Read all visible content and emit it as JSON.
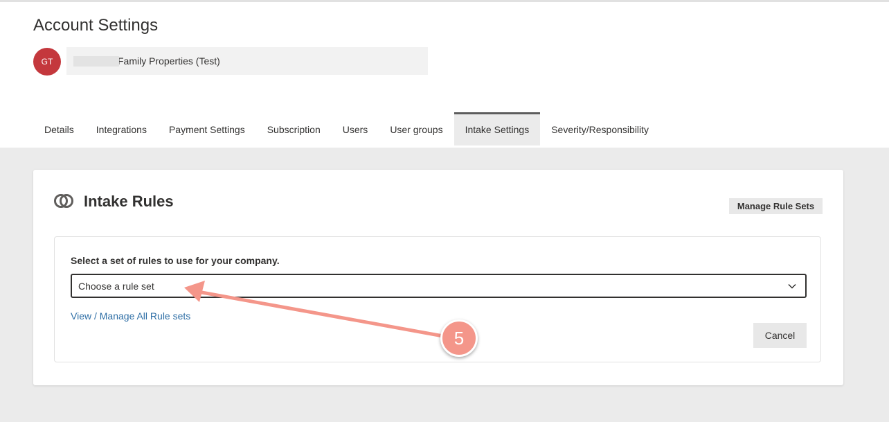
{
  "header": {
    "title": "Account Settings",
    "avatar_initials": "GT",
    "company_name": "Family Properties (Test)"
  },
  "tabs": [
    {
      "label": "Details",
      "active": false
    },
    {
      "label": "Integrations",
      "active": false
    },
    {
      "label": "Payment Settings",
      "active": false
    },
    {
      "label": "Subscription",
      "active": false
    },
    {
      "label": "Users",
      "active": false
    },
    {
      "label": "User groups",
      "active": false
    },
    {
      "label": "Intake Settings",
      "active": true
    },
    {
      "label": "Severity/Responsibility",
      "active": false
    }
  ],
  "card": {
    "title": "Intake Rules",
    "manage_button": "Manage Rule Sets",
    "select_label": "Select a set of rules to use for your company.",
    "select_value": "Choose a rule set",
    "view_link": "View / Manage All Rule sets",
    "cancel_button": "Cancel"
  },
  "annotation": {
    "step_number": "5"
  },
  "colors": {
    "avatar": "#c4383d",
    "link": "#2f6fa6",
    "annotation": "#f4968a"
  }
}
